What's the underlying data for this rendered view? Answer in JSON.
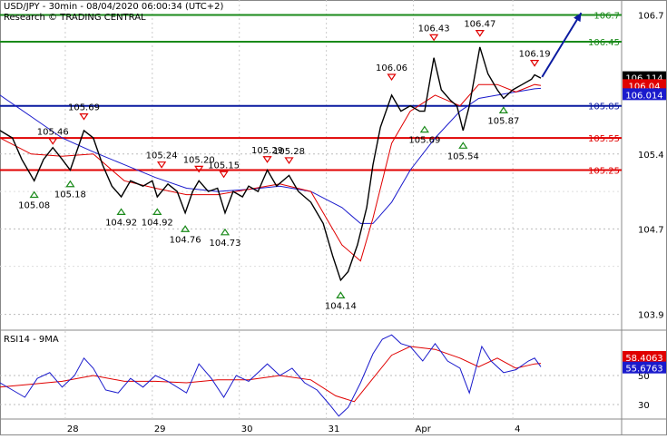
{
  "header": {
    "title": "USD/JPY - 30min - 08/04/2020 06:00:34 (UTC+2)",
    "source": "Research © TRADING CENTRAL"
  },
  "rsi_panel": {
    "label": "RSI14 - 9MA"
  },
  "colors": {
    "price": "#000000",
    "ma_fast": "#e00000",
    "ma_slow": "#1a1acc",
    "resistance": "#1a8a1a",
    "pivot": "#0a1aa0",
    "support": "#e00000",
    "arrow": "#0a1aa0",
    "up_marker": "#1a8a1a",
    "down_marker": "#e00000"
  },
  "chart_data": [
    {
      "type": "line",
      "x_ticks": [
        "28",
        "29",
        "30",
        "31",
        "Apr",
        "4"
      ],
      "y_ticks": [
        103.9,
        104.7,
        105.4,
        106.7
      ],
      "ylim": [
        103.77,
        106.84
      ],
      "current_price_label": "106.114",
      "red_price_label": "106.04",
      "blue_price_label": "106.014",
      "levels": [
        {
          "value": 106.7,
          "label": "106.7",
          "kind": "resistance"
        },
        {
          "value": 106.45,
          "label": "106.45",
          "kind": "resistance"
        },
        {
          "value": 105.85,
          "label": "105.85",
          "kind": "pivot"
        },
        {
          "value": 105.55,
          "label": "105.55",
          "kind": "support"
        },
        {
          "value": 105.25,
          "label": "105.25",
          "kind": "support"
        }
      ],
      "annotations": [
        {
          "label": "105.69",
          "value": 105.69,
          "kind": "high",
          "x_frac": 0.135
        },
        {
          "label": "105.46",
          "value": 105.46,
          "kind": "high",
          "x_frac": 0.085
        },
        {
          "label": "105.24",
          "value": 105.24,
          "kind": "high",
          "x_frac": 0.26
        },
        {
          "label": "105.20",
          "value": 105.2,
          "kind": "high",
          "x_frac": 0.32
        },
        {
          "label": "105.15",
          "value": 105.15,
          "kind": "high",
          "x_frac": 0.36
        },
        {
          "label": "105.29",
          "value": 105.29,
          "kind": "high",
          "x_frac": 0.43
        },
        {
          "label": "105.28",
          "value": 105.28,
          "kind": "high",
          "x_frac": 0.465
        },
        {
          "label": "106.06",
          "value": 106.06,
          "kind": "high",
          "x_frac": 0.63
        },
        {
          "label": "106.43",
          "value": 106.43,
          "kind": "high",
          "x_frac": 0.698
        },
        {
          "label": "106.47",
          "value": 106.47,
          "kind": "high",
          "x_frac": 0.772
        },
        {
          "label": "106.19",
          "value": 106.19,
          "kind": "high",
          "x_frac": 0.86
        },
        {
          "label": "105.08",
          "value": 105.08,
          "kind": "low",
          "x_frac": 0.055
        },
        {
          "label": "105.18",
          "value": 105.18,
          "kind": "low",
          "x_frac": 0.113
        },
        {
          "label": "104.92",
          "value": 104.92,
          "kind": "low",
          "x_frac": 0.195
        },
        {
          "label": "104.92",
          "value": 104.92,
          "kind": "low",
          "x_frac": 0.253
        },
        {
          "label": "104.76",
          "value": 104.76,
          "kind": "low",
          "x_frac": 0.298
        },
        {
          "label": "104.73",
          "value": 104.73,
          "kind": "low",
          "x_frac": 0.362
        },
        {
          "label": "104.14",
          "value": 104.14,
          "kind": "low",
          "x_frac": 0.548
        },
        {
          "label": "105.69",
          "value": 105.69,
          "kind": "low",
          "x_frac": 0.683
        },
        {
          "label": "105.54",
          "value": 105.54,
          "kind": "low",
          "x_frac": 0.745
        },
        {
          "label": "105.87",
          "value": 105.87,
          "kind": "low",
          "x_frac": 0.81
        }
      ],
      "price_path": [
        [
          0.0,
          105.62
        ],
        [
          0.02,
          105.55
        ],
        [
          0.035,
          105.35
        ],
        [
          0.055,
          105.15
        ],
        [
          0.07,
          105.35
        ],
        [
          0.085,
          105.46
        ],
        [
          0.1,
          105.35
        ],
        [
          0.113,
          105.25
        ],
        [
          0.125,
          105.45
        ],
        [
          0.135,
          105.62
        ],
        [
          0.15,
          105.55
        ],
        [
          0.165,
          105.3
        ],
        [
          0.18,
          105.1
        ],
        [
          0.195,
          105.0
        ],
        [
          0.21,
          105.15
        ],
        [
          0.23,
          105.1
        ],
        [
          0.245,
          105.15
        ],
        [
          0.253,
          105.0
        ],
        [
          0.27,
          105.12
        ],
        [
          0.285,
          105.05
        ],
        [
          0.298,
          104.85
        ],
        [
          0.31,
          105.05
        ],
        [
          0.32,
          105.15
        ],
        [
          0.335,
          105.05
        ],
        [
          0.35,
          105.08
        ],
        [
          0.362,
          104.85
        ],
        [
          0.375,
          105.05
        ],
        [
          0.39,
          105.0
        ],
        [
          0.4,
          105.1
        ],
        [
          0.415,
          105.05
        ],
        [
          0.43,
          105.25
        ],
        [
          0.445,
          105.1
        ],
        [
          0.465,
          105.2
        ],
        [
          0.48,
          105.05
        ],
        [
          0.5,
          104.95
        ],
        [
          0.52,
          104.75
        ],
        [
          0.535,
          104.45
        ],
        [
          0.548,
          104.22
        ],
        [
          0.56,
          104.3
        ],
        [
          0.575,
          104.55
        ],
        [
          0.59,
          104.9
        ],
        [
          0.6,
          105.3
        ],
        [
          0.612,
          105.65
        ],
        [
          0.63,
          105.95
        ],
        [
          0.645,
          105.8
        ],
        [
          0.66,
          105.85
        ],
        [
          0.675,
          105.8
        ],
        [
          0.683,
          105.8
        ],
        [
          0.698,
          106.3
        ],
        [
          0.71,
          106.0
        ],
        [
          0.725,
          105.9
        ],
        [
          0.735,
          105.85
        ],
        [
          0.745,
          105.62
        ],
        [
          0.755,
          105.85
        ],
        [
          0.772,
          106.4
        ],
        [
          0.785,
          106.15
        ],
        [
          0.8,
          106.0
        ],
        [
          0.81,
          105.92
        ],
        [
          0.825,
          106.0
        ],
        [
          0.84,
          106.05
        ],
        [
          0.855,
          106.1
        ],
        [
          0.86,
          106.14
        ],
        [
          0.87,
          106.11
        ]
      ],
      "ma_fast_path": [
        [
          0.0,
          105.55
        ],
        [
          0.05,
          105.4
        ],
        [
          0.1,
          105.38
        ],
        [
          0.15,
          105.4
        ],
        [
          0.2,
          105.15
        ],
        [
          0.25,
          105.08
        ],
        [
          0.3,
          105.02
        ],
        [
          0.35,
          105.02
        ],
        [
          0.4,
          105.07
        ],
        [
          0.45,
          105.12
        ],
        [
          0.5,
          105.05
        ],
        [
          0.55,
          104.55
        ],
        [
          0.58,
          104.4
        ],
        [
          0.6,
          104.8
        ],
        [
          0.63,
          105.5
        ],
        [
          0.66,
          105.8
        ],
        [
          0.7,
          105.95
        ],
        [
          0.74,
          105.85
        ],
        [
          0.77,
          106.05
        ],
        [
          0.8,
          106.05
        ],
        [
          0.83,
          105.98
        ],
        [
          0.86,
          106.05
        ],
        [
          0.87,
          106.04
        ]
      ],
      "ma_slow_path": [
        [
          0.0,
          105.95
        ],
        [
          0.05,
          105.75
        ],
        [
          0.1,
          105.55
        ],
        [
          0.15,
          105.42
        ],
        [
          0.2,
          105.3
        ],
        [
          0.25,
          105.18
        ],
        [
          0.3,
          105.08
        ],
        [
          0.35,
          105.05
        ],
        [
          0.4,
          105.07
        ],
        [
          0.45,
          105.1
        ],
        [
          0.5,
          105.05
        ],
        [
          0.55,
          104.9
        ],
        [
          0.58,
          104.75
        ],
        [
          0.6,
          104.75
        ],
        [
          0.63,
          104.95
        ],
        [
          0.66,
          105.25
        ],
        [
          0.7,
          105.55
        ],
        [
          0.74,
          105.8
        ],
        [
          0.77,
          105.92
        ],
        [
          0.8,
          105.95
        ],
        [
          0.83,
          105.98
        ],
        [
          0.86,
          106.01
        ],
        [
          0.87,
          106.014
        ]
      ],
      "forecast_arrow": {
        "from": [
          0.872,
          106.12
        ],
        "to": [
          0.935,
          106.72
        ]
      }
    },
    {
      "type": "line",
      "title": "RSI14 - 9MA",
      "y_ticks": [
        30,
        50
      ],
      "ylim": [
        20,
        80
      ],
      "rsi_label": "55.6763",
      "ma_label": "58.4063",
      "rsi_path": [
        [
          0.0,
          45
        ],
        [
          0.02,
          40
        ],
        [
          0.04,
          35
        ],
        [
          0.06,
          48
        ],
        [
          0.08,
          52
        ],
        [
          0.1,
          42
        ],
        [
          0.12,
          50
        ],
        [
          0.135,
          62
        ],
        [
          0.15,
          55
        ],
        [
          0.17,
          40
        ],
        [
          0.19,
          38
        ],
        [
          0.21,
          48
        ],
        [
          0.23,
          42
        ],
        [
          0.25,
          50
        ],
        [
          0.27,
          46
        ],
        [
          0.3,
          38
        ],
        [
          0.32,
          58
        ],
        [
          0.34,
          48
        ],
        [
          0.36,
          35
        ],
        [
          0.38,
          50
        ],
        [
          0.4,
          46
        ],
        [
          0.43,
          58
        ],
        [
          0.45,
          50
        ],
        [
          0.47,
          55
        ],
        [
          0.49,
          45
        ],
        [
          0.51,
          40
        ],
        [
          0.53,
          30
        ],
        [
          0.545,
          22
        ],
        [
          0.56,
          28
        ],
        [
          0.58,
          45
        ],
        [
          0.6,
          65
        ],
        [
          0.615,
          75
        ],
        [
          0.63,
          78
        ],
        [
          0.645,
          72
        ],
        [
          0.66,
          70
        ],
        [
          0.68,
          60
        ],
        [
          0.7,
          72
        ],
        [
          0.72,
          60
        ],
        [
          0.74,
          55
        ],
        [
          0.755,
          38
        ],
        [
          0.775,
          70
        ],
        [
          0.79,
          60
        ],
        [
          0.81,
          52
        ],
        [
          0.83,
          54
        ],
        [
          0.85,
          60
        ],
        [
          0.86,
          62
        ],
        [
          0.87,
          56
        ]
      ],
      "ma_path": [
        [
          0.0,
          42
        ],
        [
          0.05,
          44
        ],
        [
          0.1,
          46
        ],
        [
          0.15,
          50
        ],
        [
          0.2,
          46
        ],
        [
          0.25,
          46
        ],
        [
          0.3,
          45
        ],
        [
          0.35,
          47
        ],
        [
          0.4,
          47
        ],
        [
          0.45,
          50
        ],
        [
          0.5,
          47
        ],
        [
          0.54,
          36
        ],
        [
          0.57,
          32
        ],
        [
          0.6,
          48
        ],
        [
          0.63,
          64
        ],
        [
          0.66,
          70
        ],
        [
          0.7,
          68
        ],
        [
          0.74,
          62
        ],
        [
          0.77,
          56
        ],
        [
          0.8,
          62
        ],
        [
          0.83,
          55
        ],
        [
          0.86,
          58
        ],
        [
          0.87,
          58.4
        ]
      ]
    }
  ]
}
